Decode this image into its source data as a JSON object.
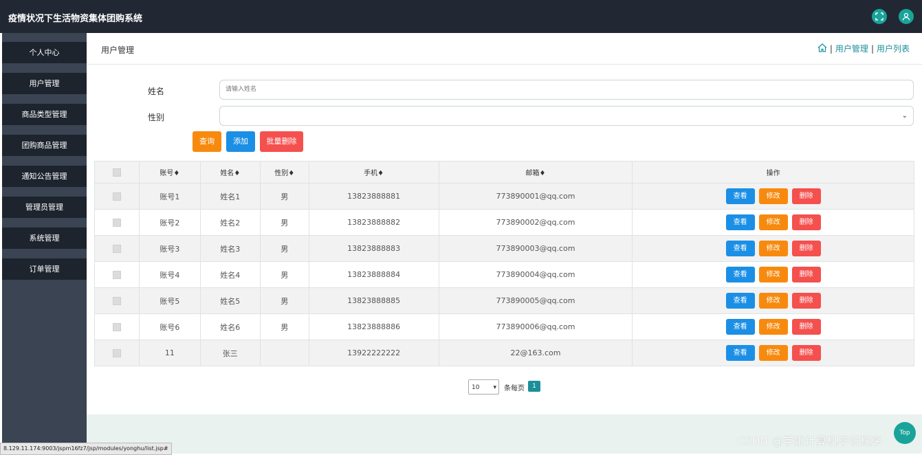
{
  "app": {
    "title": "疫情状况下生活物资集体团购系统"
  },
  "topbar": {
    "fullscreen_icon": "fullscreen-icon",
    "user_icon": "user-icon"
  },
  "sidebar": {
    "items": [
      {
        "label": "个人中心"
      },
      {
        "label": "用户管理"
      },
      {
        "label": "商品类型管理"
      },
      {
        "label": "团购商品管理"
      },
      {
        "label": "通知公告管理"
      },
      {
        "label": "管理员管理"
      },
      {
        "label": "系统管理"
      },
      {
        "label": "订单管理"
      }
    ]
  },
  "header": {
    "title": "用户管理",
    "breadcrumb": {
      "sep": "|",
      "item1": "用户管理",
      "item2": "用户列表"
    }
  },
  "search": {
    "name_label": "姓名",
    "name_placeholder": "请输入姓名",
    "gender_label": "性别",
    "gender_value": ""
  },
  "buttons": {
    "query": "查询",
    "add": "添加",
    "batch_delete": "批量删除"
  },
  "colors": {
    "query": "#f78a0e",
    "add": "#1b8fe6",
    "batch_delete": "#f4504e",
    "accent": "#1aa39a"
  },
  "table": {
    "headers": {
      "account": "账号",
      "name": "姓名",
      "gender": "性别",
      "phone": "手机",
      "email": "邮箱",
      "ops": "操作"
    },
    "sort_mark": "♦",
    "actions": {
      "view": "查看",
      "edit": "修改",
      "delete": "删除"
    },
    "rows": [
      {
        "account": "账号1",
        "name": "姓名1",
        "gender": "男",
        "phone": "13823888881",
        "email": "773890001@qq.com"
      },
      {
        "account": "账号2",
        "name": "姓名2",
        "gender": "男",
        "phone": "13823888882",
        "email": "773890002@qq.com"
      },
      {
        "account": "账号3",
        "name": "姓名3",
        "gender": "男",
        "phone": "13823888883",
        "email": "773890003@qq.com"
      },
      {
        "account": "账号4",
        "name": "姓名4",
        "gender": "男",
        "phone": "13823888884",
        "email": "773890004@qq.com"
      },
      {
        "account": "账号5",
        "name": "姓名5",
        "gender": "男",
        "phone": "13823888885",
        "email": "773890005@qq.com"
      },
      {
        "account": "账号6",
        "name": "姓名6",
        "gender": "男",
        "phone": "13823888886",
        "email": "773890006@qq.com"
      },
      {
        "account": "11",
        "name": "张三",
        "gender": "",
        "phone": "13922222222",
        "email": "22@163.com"
      }
    ]
  },
  "pagination": {
    "page_size": "10",
    "per_page_label": "条每页",
    "current_page": "1"
  },
  "top_button": "Top",
  "watermark": "CSDN @学姐计算机毕设程序",
  "status_url": "8.129.11.174:9003/jspm16fz7/jsp/modules/yonghu/list.jsp#"
}
